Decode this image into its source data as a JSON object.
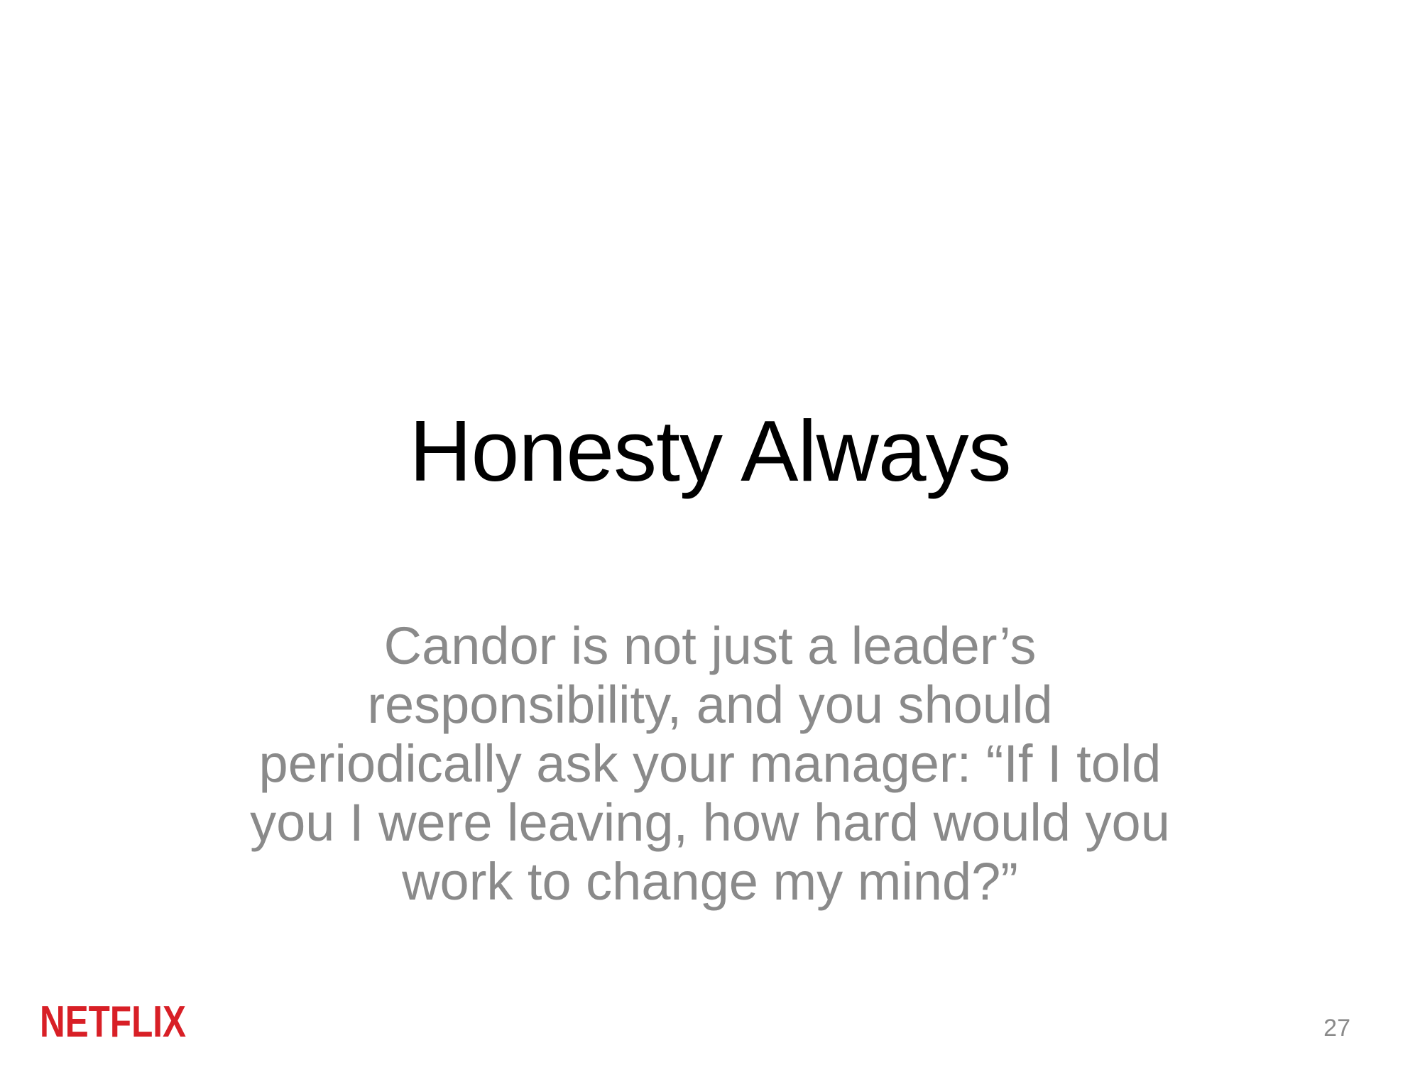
{
  "slide": {
    "title": "Honesty Always",
    "body_lines": [
      "Candor is not just a leader’s",
      "responsibility, and you should",
      "periodically ask your manager: “If I told",
      "you I were leaving, how hard would you",
      "work to change my mind?”"
    ],
    "logo_text": "NETFLIX",
    "page_number": "27"
  },
  "colors": {
    "title": "#000000",
    "body_text": "#8a8a8a",
    "logo": "#d81f26",
    "background": "#ffffff"
  },
  "icons": {
    "logo": "netflix-logo"
  }
}
